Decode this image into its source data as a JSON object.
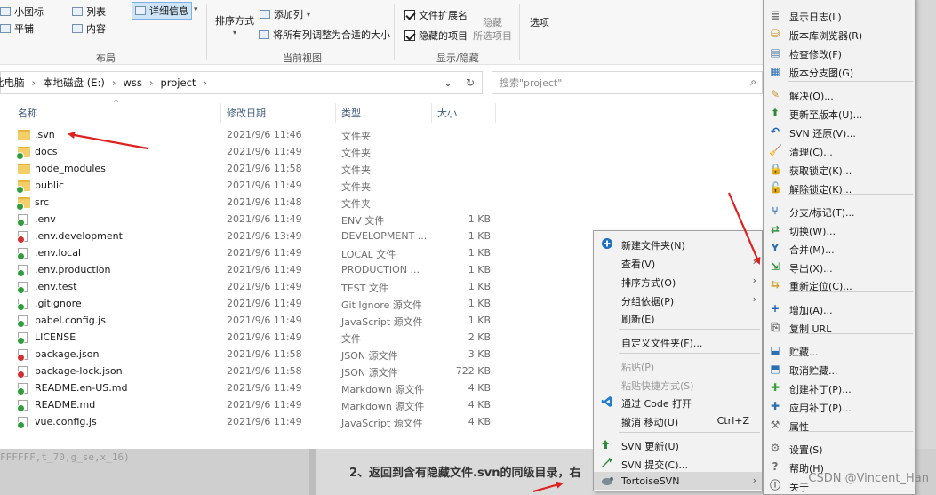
{
  "ribbon": {
    "layout": {
      "small_icons": "小图标",
      "list": "列表",
      "details": "详细信息",
      "tiles": "平铺",
      "content": "内容",
      "group_label": "布局"
    },
    "current_view": {
      "sort_by": "排序方式",
      "add_column": "添加列",
      "fit_columns": "将所有列调整为合适的大小",
      "group_label": "当前视图"
    },
    "show_hide": {
      "file_extensions": "文件扩展名",
      "hidden_items": "隐藏的项目",
      "hide": "隐藏",
      "hide_selected": "所选项目",
      "group_label": "显示/隐藏"
    },
    "options": "选项"
  },
  "address": {
    "crumbs": [
      "此电脑",
      "本地磁盘 (E:)",
      "wss",
      "project"
    ],
    "search_placeholder": "搜索\"project\""
  },
  "columns": {
    "name": "名称",
    "modified": "修改日期",
    "type": "类型",
    "size": "大小"
  },
  "files": [
    {
      "name": ".svn",
      "date": "2021/9/6 11:46",
      "type": "文件夹",
      "size": "",
      "kind": "folder",
      "status": "none"
    },
    {
      "name": "docs",
      "date": "2021/9/6 11:49",
      "type": "文件夹",
      "size": "",
      "kind": "folder",
      "status": "ok"
    },
    {
      "name": "node_modules",
      "date": "2021/9/6 11:58",
      "type": "文件夹",
      "size": "",
      "kind": "folder",
      "status": "none"
    },
    {
      "name": "public",
      "date": "2021/9/6 11:49",
      "type": "文件夹",
      "size": "",
      "kind": "folder",
      "status": "ok"
    },
    {
      "name": "src",
      "date": "2021/9/6 11:48",
      "type": "文件夹",
      "size": "",
      "kind": "folder",
      "status": "ok"
    },
    {
      "name": ".env",
      "date": "2021/9/6 11:49",
      "type": "ENV 文件",
      "size": "1 KB",
      "kind": "file",
      "status": "ok"
    },
    {
      "name": ".env.development",
      "date": "2021/9/6 13:49",
      "type": "DEVELOPMENT ...",
      "size": "1 KB",
      "kind": "file",
      "status": "mod"
    },
    {
      "name": ".env.local",
      "date": "2021/9/6 11:49",
      "type": "LOCAL 文件",
      "size": "1 KB",
      "kind": "file",
      "status": "ok"
    },
    {
      "name": ".env.production",
      "date": "2021/9/6 11:49",
      "type": "PRODUCTION ...",
      "size": "1 KB",
      "kind": "file",
      "status": "ok"
    },
    {
      "name": ".env.test",
      "date": "2021/9/6 11:49",
      "type": "TEST 文件",
      "size": "1 KB",
      "kind": "file",
      "status": "ok"
    },
    {
      "name": ".gitignore",
      "date": "2021/9/6 11:49",
      "type": "Git Ignore 源文件",
      "size": "1 KB",
      "kind": "file",
      "status": "ok"
    },
    {
      "name": "babel.config.js",
      "date": "2021/9/6 11:49",
      "type": "JavaScript 源文件",
      "size": "1 KB",
      "kind": "file",
      "status": "ok"
    },
    {
      "name": "LICENSE",
      "date": "2021/9/6 11:49",
      "type": "文件",
      "size": "2 KB",
      "kind": "file",
      "status": "ok"
    },
    {
      "name": "package.json",
      "date": "2021/9/6 11:58",
      "type": "JSON 源文件",
      "size": "3 KB",
      "kind": "file",
      "status": "mod"
    },
    {
      "name": "package-lock.json",
      "date": "2021/9/6 11:58",
      "type": "JSON 源文件",
      "size": "722 KB",
      "kind": "file",
      "status": "mod"
    },
    {
      "name": "README.en-US.md",
      "date": "2021/9/6 11:49",
      "type": "Markdown 源文件",
      "size": "4 KB",
      "kind": "file",
      "status": "ok"
    },
    {
      "name": "README.md",
      "date": "2021/9/6 11:49",
      "type": "Markdown 源文件",
      "size": "4 KB",
      "kind": "file",
      "status": "ok"
    },
    {
      "name": "vue.config.js",
      "date": "2021/9/6 11:49",
      "type": "JavaScript 源文件",
      "size": "4 KB",
      "kind": "file",
      "status": "ok"
    }
  ],
  "context_menu": {
    "new_folder": "新建文件夹(N)",
    "view": "查看(V)",
    "sort_by": "排序方式(O)",
    "group_by": "分组依据(P)",
    "refresh": "刷新(E)",
    "customize_folder": "自定义文件夹(F)...",
    "paste": "粘贴(P)",
    "paste_shortcut": "粘贴快捷方式(S)",
    "open_with_code": "通过 Code 打开",
    "undo_move": "撤消 移动(U)",
    "undo_shortcut": "Ctrl+Z",
    "svn_update": "SVN 更新(U)",
    "svn_commit": "SVN 提交(C)...",
    "tortoise_svn": "TortoiseSVN"
  },
  "svn_menu": {
    "show_log": "显示日志(L)",
    "repo_browser": "版本库浏览器(R)",
    "check_modifications": "检查修改(F)",
    "revision_graph": "版本分支图(G)",
    "resolve": "解决(O)...",
    "update_to_revision": "更新至版本(U)...",
    "revert": "SVN 还原(V)...",
    "cleanup": "清理(C)...",
    "get_lock": "获取锁定(K)...",
    "release_lock": "解除锁定(K)...",
    "branch_tag": "分支/标记(T)...",
    "switch": "切换(W)...",
    "merge": "合并(M)...",
    "export": "导出(X)...",
    "relocate": "重新定位(C)...",
    "add": "增加(A)...",
    "copy_url": "复制 URL",
    "shelve": "贮藏...",
    "unshelve": "取消贮藏...",
    "create_patch": "创建补丁(P)...",
    "apply_patch": "应用补丁(P)...",
    "properties": "属性",
    "settings": "设置(S)",
    "help": "帮助(H)",
    "about": "关于"
  },
  "background": {
    "css_fragment": "FFFFFF,t_70,g_se,x_16)",
    "article_text": "2、返回到含有隐藏文件.svn的同级目录，右",
    "watermark": "CSDN @Vincent_Han"
  },
  "colors": {
    "annotation_arrow": "#e02020",
    "accent_blue": "#1e6fc2",
    "svn_ok": "#2f9d3b",
    "svn_modified": "#d23131"
  }
}
